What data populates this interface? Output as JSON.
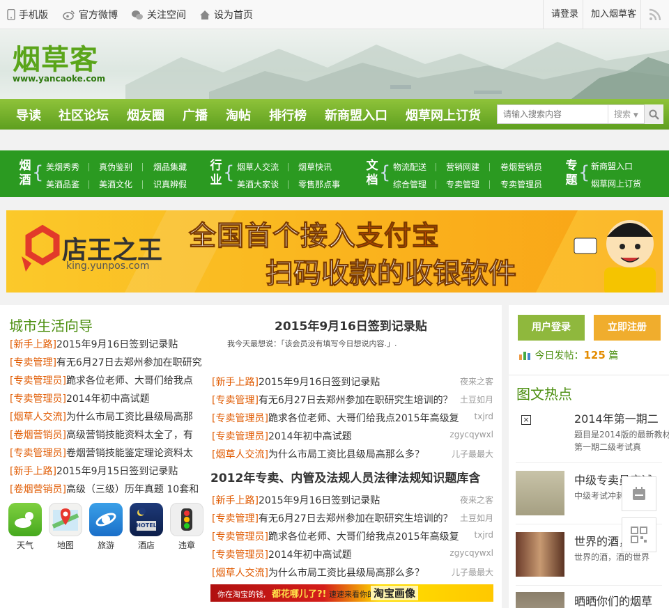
{
  "topbar": {
    "mobile": "手机版",
    "weibo": "官方微博",
    "qzone": "关注空间",
    "homepage": "设为首页",
    "login": "请登录",
    "join": "加入烟草客"
  },
  "logo": {
    "cn": "烟草客",
    "url": "www.yancaoke.com"
  },
  "nav": {
    "items": [
      "导读",
      "社区论坛",
      "烟友圈",
      "广播",
      "淘帖",
      "排行榜",
      "新商盟入口",
      "烟草网上订货"
    ],
    "search_placeholder": "请输入搜索内容",
    "search_select": "搜索"
  },
  "categories": {
    "g1": {
      "title": "烟酒",
      "links": [
        "美烟秀秀",
        "真伪鉴别",
        "烟品集藏",
        "美酒品鉴",
        "美酒文化",
        "识真辨假"
      ]
    },
    "g2": {
      "title": "行业",
      "links": [
        "烟草人交流",
        "烟草快讯",
        "美酒大家谈",
        "零售那点事"
      ]
    },
    "g3": {
      "title": "文档",
      "links": [
        "物流配送",
        "营销网建",
        "卷烟营销员",
        "综合管理",
        "专卖管理",
        "专卖管理员"
      ]
    },
    "g4": {
      "title": "专题",
      "links": [
        "新商盟入口",
        "烟草网上订货"
      ]
    }
  },
  "ad_banner": {
    "brand": "店王之王",
    "url": "king.yunpos.com",
    "line1_a": "全国首个接入",
    "line1_b": "支付宝",
    "line2": "扫码收款的收银软件"
  },
  "left": {
    "title": "城市生活向导",
    "rows": [
      {
        "tag": "[新手上路]",
        "text": "2015年9月16日签到记录贴"
      },
      {
        "tag": "[专卖管理]",
        "text": "有无6月27日去郑州参加在职研究"
      },
      {
        "tag": "[专卖管理员]",
        "text": "跪求各位老师、大哥们给我点"
      },
      {
        "tag": "[专卖管理员]",
        "text": "2014年初中高试题"
      },
      {
        "tag": "[烟草人交流]",
        "text": "为什么市局工资比县级局高那"
      },
      {
        "tag": "[卷烟营销员]",
        "text": "高级营销技能资料太全了，有"
      },
      {
        "tag": "[专卖管理员]",
        "text": "卷烟营销技能鉴定理论资料太"
      },
      {
        "tag": "[新手上路]",
        "text": "2015年9月15日签到记录贴"
      },
      {
        "tag": "[卷烟营销员]",
        "text": "高级（三级）历年真题  10套和"
      }
    ],
    "apps": [
      "天气",
      "地图",
      "旅游",
      "酒店",
      "违章"
    ],
    "hotel_label": "HOTEL"
  },
  "middle": {
    "title1": "2015年9月16日签到记录贴",
    "subtitle": "我今天最想说：「该会员没有填写今日想说内容.」.",
    "rows1": [
      {
        "tag": "[新手上路]",
        "text": "2015年9月16日签到记录贴",
        "author": "夜来之客"
      },
      {
        "tag": "[专卖管理]",
        "text": "有无6月27日去郑州参加在职研究生培训的？",
        "author": "土豆如月"
      },
      {
        "tag": "[专卖管理员]",
        "text": "跪求各位老师、大哥们给我点2015年高级复",
        "author": "txjrd"
      },
      {
        "tag": "[专卖管理员]",
        "text": "2014年初中高试题",
        "author": "zgycqywxl"
      },
      {
        "tag": "[烟草人交流]",
        "text": "为什么市局工资比县级局高那么多？",
        "author": "儿子最最大"
      }
    ],
    "title2": "2012年专卖、内管及法规人员法律法规知识题库含",
    "rows2": [
      {
        "tag": "[新手上路]",
        "text": "2015年9月16日签到记录贴",
        "author": "夜来之客"
      },
      {
        "tag": "[专卖管理]",
        "text": "有无6月27日去郑州参加在职研究生培训的？",
        "author": "土豆如月"
      },
      {
        "tag": "[专卖管理员]",
        "text": "跪求各位老师、大哥们给我点2015年高级复",
        "author": "txjrd"
      },
      {
        "tag": "[专卖管理员]",
        "text": "2014年初中高试题",
        "author": "zgycqywxl"
      },
      {
        "tag": "[烟草人交流]",
        "text": "为什么市局工资比县级局高那么多？",
        "author": "儿子最最大"
      }
    ],
    "ad2_a": "你在淘宝的钱,",
    "ad2_b": "都花哪儿了?!",
    "ad2_c": "速速来看你的",
    "ad2_d": "淘宝画像"
  },
  "right": {
    "login": "用户登录",
    "register": "立即注册",
    "today_label": "今日发帖：",
    "today_count": "125",
    "today_unit": "篇",
    "hot_title": "图文热点",
    "hot": [
      {
        "title": "2014年第一期二",
        "desc": "题目是2014版的最新教材第一期二级考试真"
      },
      {
        "title": "中级专卖员应试",
        "desc": "中级考试冲刺"
      },
      {
        "title": "世界的酒，酒的",
        "desc": "世界的酒，酒的世界"
      },
      {
        "title": "晒晒你们的烟草",
        "desc": ""
      }
    ]
  },
  "colors": {
    "green": "#5e9f1f",
    "catbar": "#2b9a21",
    "tag": "#e05a00",
    "orange": "#f0ad2d"
  }
}
